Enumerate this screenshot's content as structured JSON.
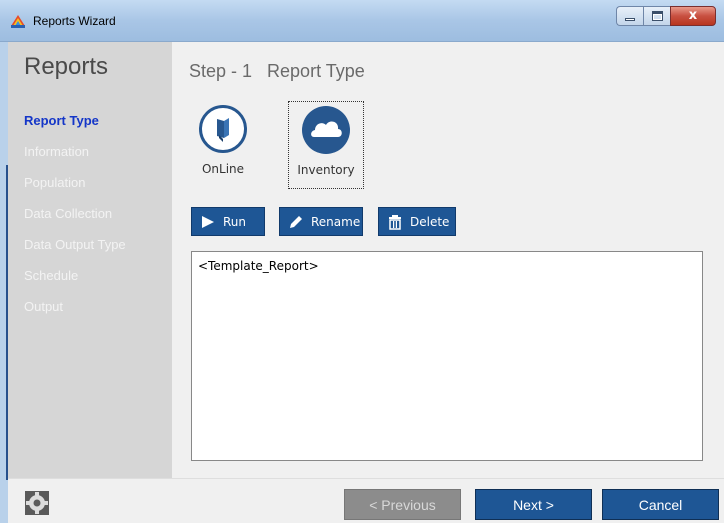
{
  "window": {
    "title": "Reports Wizard",
    "icon": "rainbow-app-icon",
    "controls": {
      "minimize": "minimize-icon",
      "maximize": "maximize-icon",
      "close": "x"
    }
  },
  "sidebar": {
    "title": "Reports",
    "items": [
      {
        "label": "Report Type",
        "active": true
      },
      {
        "label": "Information",
        "active": false
      },
      {
        "label": "Population",
        "active": false
      },
      {
        "label": "Data Collection",
        "active": false
      },
      {
        "label": "Data Output Type",
        "active": false
      },
      {
        "label": "Schedule",
        "active": false
      },
      {
        "label": "Output",
        "active": false
      }
    ]
  },
  "main": {
    "step_title": "Step - 1   Report Type",
    "report_types": [
      {
        "label": "OnLine",
        "icon": "online-book-icon",
        "selected": false
      },
      {
        "label": "Inventory",
        "icon": "inventory-cloud-icon",
        "selected": true
      }
    ],
    "actions": {
      "run_label": "Run",
      "rename_label": "Rename",
      "delete_label": "Delete"
    },
    "template_list": [
      "<Template_Report>"
    ]
  },
  "footer": {
    "settings_icon": "gear-icon",
    "previous_label": "< Previous",
    "next_label": "Next >",
    "cancel_label": "Cancel"
  },
  "colors": {
    "accent": "#1e5695",
    "active_nav": "#1436c8",
    "sidebar_bg": "#d6d6d6",
    "content_bg": "#f0f0f0",
    "disabled_button": "#8c8c8c"
  }
}
